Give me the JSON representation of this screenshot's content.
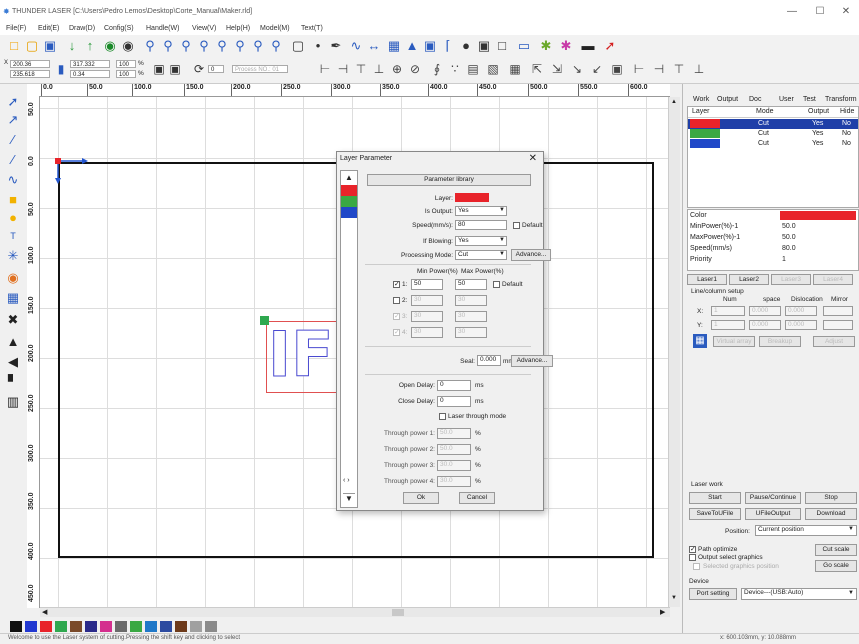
{
  "window": {
    "title": "THUNDER LASER [C:\\Users\\Pedro Lemos\\Desktop\\Corte_Manual\\Maker.rld]",
    "app_icon": "app-icon",
    "controls": [
      "—",
      "☐",
      "✕"
    ]
  },
  "menu": [
    "File(F)",
    "Edit(E)",
    "Draw(D)",
    "Config(S)",
    "Handle(W)",
    "View(V)",
    "Help(H)",
    "Model(M)",
    "Text(T)"
  ],
  "toolbar1_icons": [
    "new-icon",
    "open-icon",
    "save-icon",
    "import-icon",
    "export-icon",
    "preview-icon",
    "settings-icon",
    "zoom-in-icon",
    "zoom-out-icon",
    "zoom-fit-icon",
    "zoom-page-icon",
    "zoom-select-icon",
    "zoom-icon",
    "zoom-prev-icon",
    "frame-icon",
    "node-icon",
    "pen-icon",
    "curve-icon",
    "line-icon",
    "grid-icon",
    "align-icon",
    "array-icon",
    "sort-icon",
    "circle-icon",
    "offset-icon",
    "vector-icon",
    "color-icon",
    "laser-icon",
    "camera-icon",
    "measure-icon"
  ],
  "toolbar2": {
    "pos_x": "200.36",
    "pos_y": "235.618",
    "size_w": "317.332",
    "size_h": "0.34",
    "scale_w": "100",
    "scale_h": "100",
    "unit": "mm",
    "percent": "%",
    "angle": "0",
    "process_no": "Process NO.: 01"
  },
  "ruler_h": [
    "0.0",
    "50.0",
    "100.0",
    "150.0",
    "200.0",
    "250.0",
    "300.0",
    "350.0",
    "400.0",
    "450.0",
    "500.0",
    "550.0",
    "600.0"
  ],
  "ruler_v": [
    "50.0",
    "0.0",
    "50.0",
    "100.0",
    "150.0",
    "200.0",
    "250.0",
    "300.0",
    "350.0",
    "400.0",
    "450.0"
  ],
  "tools": [
    "select-tool-icon",
    "node-tool-icon",
    "line-tool-icon",
    "polyline-tool-icon",
    "curve-tool-icon",
    "rect-tool-icon",
    "ellipse-tool-icon",
    "text-tool-icon",
    "dot-tool-icon",
    "color-tool-icon",
    "grid-tool-icon",
    "delete-tool-icon",
    "align-up-tool-icon",
    "align-left-tool-icon",
    "align-center-tool-icon",
    "align-more-tool-icon"
  ],
  "canvas": {
    "design_text": "IF"
  },
  "dialog": {
    "title": "Layer Parameter",
    "close": "✕",
    "library_button": "Parameter library",
    "layer_label": "Layer:",
    "layer_color": "#e8232a",
    "is_output_label": "Is Output:",
    "is_output_value": "Yes",
    "speed_label": "Speed(mm/s):",
    "speed_value": "80",
    "default_label": "Default",
    "if_blowing_label": "If Blowing:",
    "if_blowing_value": "Yes",
    "processing_mode_label": "Processing Mode:",
    "processing_mode_value": "Cut",
    "advance_button": "Advance...",
    "min_power_header": "Min Power(%)",
    "max_power_header": "Max Power(%)",
    "power_rows": [
      {
        "label": "1:",
        "min": "50",
        "max": "50",
        "checked": true,
        "enabled": true
      },
      {
        "label": "2:",
        "min": "30",
        "max": "30",
        "checked": false,
        "enabled": false
      },
      {
        "label": "3:",
        "min": "30",
        "max": "30",
        "checked": true,
        "enabled": false
      },
      {
        "label": "4:",
        "min": "30",
        "max": "30",
        "checked": true,
        "enabled": false
      }
    ],
    "seal_label": "Seal:",
    "seal_value": "0.000",
    "seal_unit": "mm",
    "seal_advance": "Advance...",
    "open_delay_label": "Open Delay:",
    "open_delay_value": "0",
    "close_delay_label": "Close Delay:",
    "close_delay_value": "0",
    "delay_unit": "ms",
    "laser_through_label": "Laser through mode",
    "through_power": [
      {
        "label": "Through power 1:",
        "value": "50.0"
      },
      {
        "label": "Through power 2:",
        "value": "50.0"
      },
      {
        "label": "Through power 3:",
        "value": "30.0"
      },
      {
        "label": "Through power 4:",
        "value": "30.0"
      }
    ],
    "percent": "%",
    "ok_button": "Ok",
    "cancel_button": "Cancel",
    "list_colors": [
      "#e8232a",
      "#3aa843",
      "#2048c8"
    ]
  },
  "right_panel": {
    "tabs": [
      "Work",
      "Output",
      "Doc",
      "User",
      "Test",
      "Transform"
    ],
    "layer_headers": [
      "Layer",
      "Mode",
      "Output",
      "Hide"
    ],
    "layers": [
      {
        "color": "#e8232a",
        "mode": "Cut",
        "output": "Yes",
        "hide": "No",
        "selected": true
      },
      {
        "color": "#3aa843",
        "mode": "Cut",
        "output": "Yes",
        "hide": "No",
        "selected": false
      },
      {
        "color": "#2048c8",
        "mode": "Cut",
        "output": "Yes",
        "hide": "No",
        "selected": false
      }
    ],
    "props": [
      {
        "label": "Color",
        "value": ""
      },
      {
        "label": "MinPower(%)-1",
        "value": "50.0"
      },
      {
        "label": "MaxPower(%)-1",
        "value": "50.0"
      },
      {
        "label": "Speed(mm/s)",
        "value": "80.0"
      },
      {
        "label": "Priority",
        "value": "1"
      }
    ],
    "prop_color": "#e8232a",
    "laser_buttons": [
      "Laser1",
      "Laser2",
      "Laser3",
      "Laser4"
    ],
    "line_column_setup": "Line/column setup",
    "grid_headers": [
      "Num",
      "space",
      "Dislocation",
      "Mirror"
    ],
    "x_label": "X:",
    "y_label": "Y:",
    "x_values": [
      "1",
      "0.000",
      "0.000"
    ],
    "y_values": [
      "1",
      "0.000",
      "0.000"
    ],
    "virtual_array": "Virtual array",
    "breakup": "Breakup",
    "adjust": "Adjust",
    "laser_work": "Laser work",
    "start": "Start",
    "pause": "Pause/Continue",
    "stop": "Stop",
    "save_to_ufile": "SaveToUFile",
    "ufile_output": "UFileOutput",
    "download": "Download",
    "position_label": "Position:",
    "position_value": "Current position",
    "path_optimize": "Path optimize",
    "output_select": "Output select graphics",
    "selected_graphics": "Selected graphics position",
    "cut_scale": "Cut scale",
    "go_scale": "Go scale",
    "device_label": "Device",
    "port_setting": "Port setting",
    "device_value": "Device---(USB:Auto)"
  },
  "palette": [
    "#111111",
    "#2238d0",
    "#e8232a",
    "#2fa84f",
    "#7a4a2a",
    "#2a2a8a",
    "#d42f8e",
    "#6a6a6a",
    "#3aa843",
    "#1f78c8",
    "#2c4aa0",
    "#6d3a1a",
    "#a0a0a0",
    "#8a8a8a"
  ],
  "status": {
    "message": "Welcome to use the Laser system of cutting.Pressing the shift key and clicking to select",
    "coords": "x: 600.103mm, y: 10.088mm"
  }
}
